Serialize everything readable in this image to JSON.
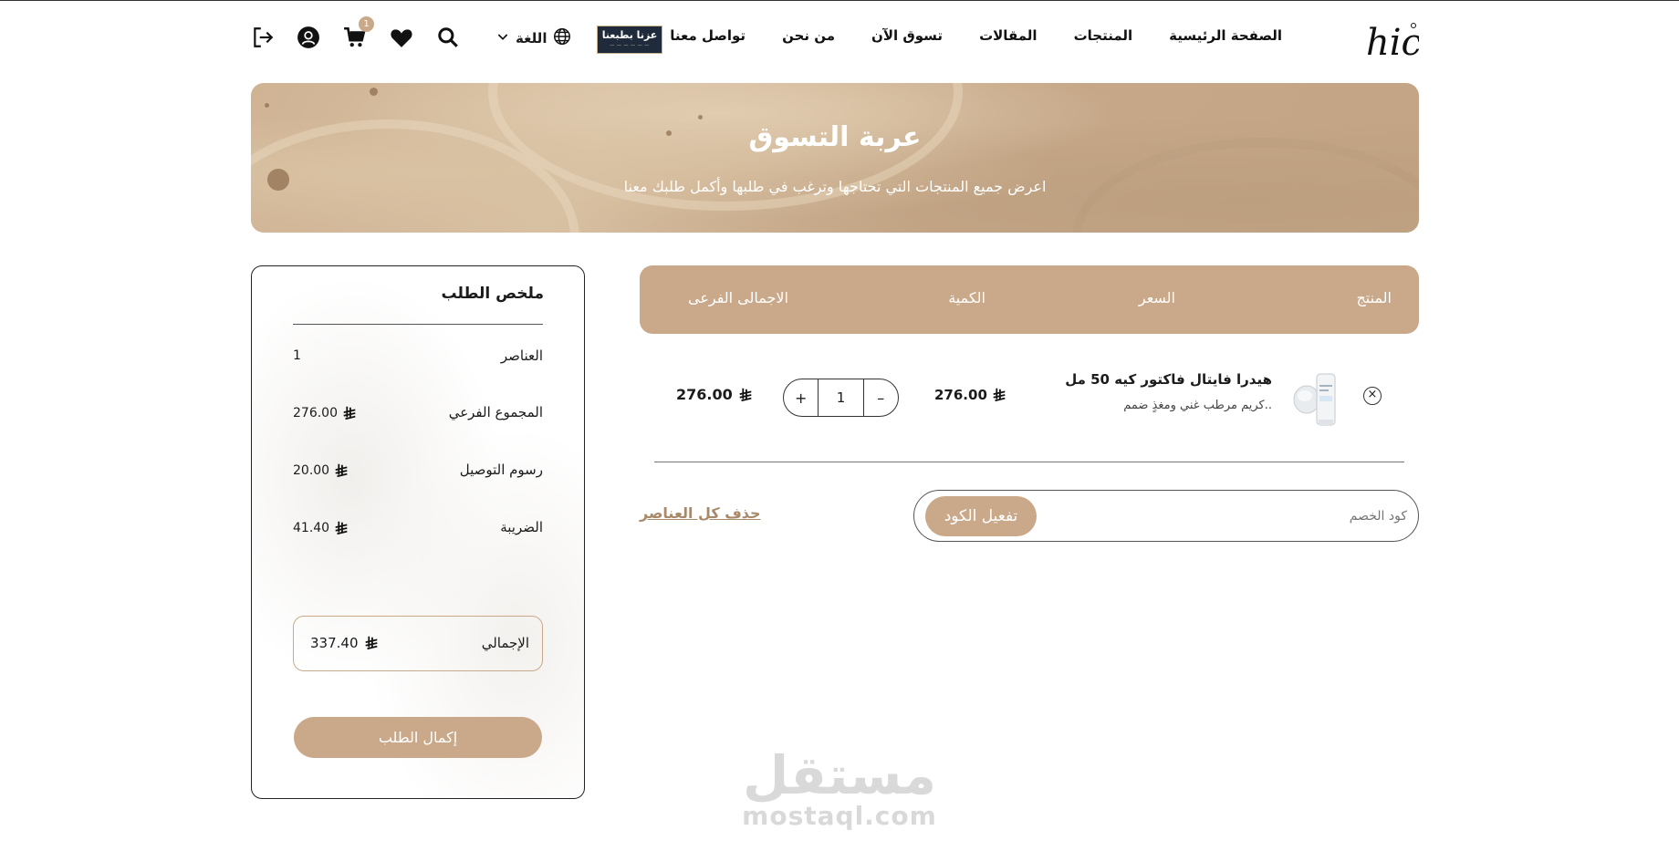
{
  "header": {
    "logo_text": "hic",
    "nav": [
      "الصفحة الرئيسية",
      "المنتجات",
      "المقالات",
      "تسوق الآن",
      "من نحن",
      "تواصل معنا"
    ],
    "badge_logo_title": "عزنا بطبعنا",
    "language_label": "اللغة",
    "cart_count": "1",
    "icons": [
      "globe-icon",
      "chevron-down-icon",
      "search-icon",
      "heart-icon",
      "cart-icon",
      "user-icon",
      "logout-icon"
    ]
  },
  "banner": {
    "title": "عربة التسوق",
    "subtitle": "اعرض جميع المنتجات التي تحتاجها وترغب في طلبها وأكمل طلبك معنا"
  },
  "cart": {
    "columns": [
      "المنتج",
      "السعر",
      "الكمية",
      "الاجمالى الفرعى"
    ],
    "items": [
      {
        "name": "هيدرا فايتال فاكتور كيه 50 مل",
        "description": "كريم مرطب غني ومغذٍ ضمم..",
        "price": "276.00",
        "quantity": "1",
        "subtotal": "276.00",
        "stepper_minus": "–",
        "stepper_plus": "+"
      }
    ],
    "coupon_placeholder": "كود الخصم",
    "apply_label": "تفعيل الكود",
    "clear_all_label": "حذف كل العناصر"
  },
  "summary": {
    "title": "ملخص الطلب",
    "rows": [
      {
        "label": "العناصر",
        "value": "1"
      },
      {
        "label": "المجموع الفرعي",
        "value": "276.00"
      },
      {
        "label": "رسوم التوصيل",
        "value": "20.00"
      },
      {
        "label": "الضريبة",
        "value": "41.40"
      }
    ],
    "total_label": "الإجمالي",
    "total_value": "337.40",
    "checkout_label": "إكمال الطلب"
  },
  "watermark": {
    "arabic": "مستقل",
    "latin": "mostaql.com"
  },
  "colors": {
    "accent": "#c9a989",
    "text": "#1b1b1b",
    "link": "#a88a6a"
  }
}
